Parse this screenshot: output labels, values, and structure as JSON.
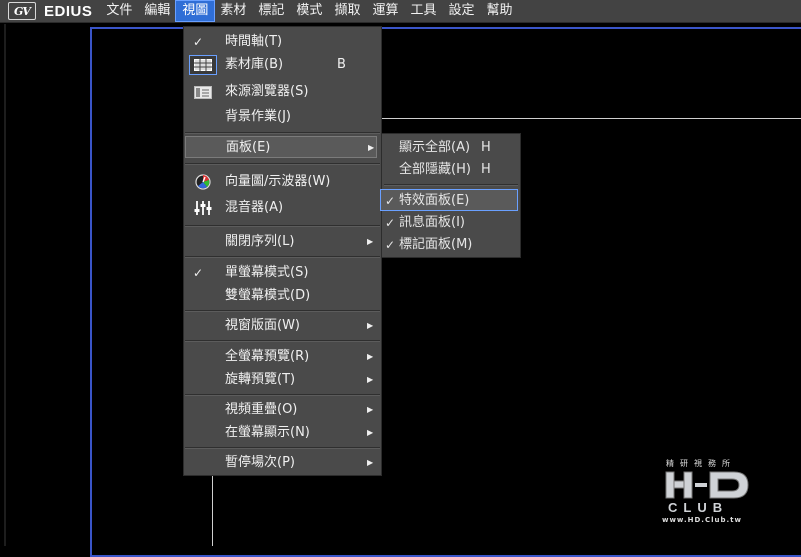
{
  "app": {
    "logo_mark": "GV",
    "name": "EDIUS"
  },
  "menubar": {
    "items": [
      {
        "label": "文件"
      },
      {
        "label": "編輯"
      },
      {
        "label": "視圖",
        "active": true
      },
      {
        "label": "素材"
      },
      {
        "label": "標記"
      },
      {
        "label": "模式"
      },
      {
        "label": "擷取"
      },
      {
        "label": "運算"
      },
      {
        "label": "工具"
      },
      {
        "label": "設定"
      },
      {
        "label": "幫助"
      }
    ]
  },
  "view_menu": {
    "items": [
      {
        "label": "時間軸(T)",
        "checked": true
      },
      {
        "label": "素材庫(B)",
        "shortcut": "B",
        "icon": "grid-icon"
      },
      {
        "label": "來源瀏覽器(S)",
        "icon": "browser-icon"
      },
      {
        "label": "背景作業(J)"
      },
      {
        "label": "面板(E)",
        "submenu": true
      },
      {
        "label": "向量圖/示波器(W)",
        "icon": "vectorscope-icon"
      },
      {
        "label": "混音器(A)",
        "icon": "mixer-icon"
      },
      {
        "label": "關閉序列(L)",
        "submenu": true
      },
      {
        "label": "單螢幕模式(S)",
        "checked": true
      },
      {
        "label": "雙螢幕模式(D)"
      },
      {
        "label": "視窗版面(W)",
        "submenu": true
      },
      {
        "label": "全螢幕預覽(R)",
        "submenu": true
      },
      {
        "label": "旋轉預覽(T)",
        "submenu": true
      },
      {
        "label": "視頻重疊(O)",
        "submenu": true
      },
      {
        "label": "在螢幕顯示(N)",
        "submenu": true
      },
      {
        "label": "暫停場次(P)",
        "submenu": true
      }
    ],
    "check_glyph": "✓",
    "arrow_glyph": "▶"
  },
  "panel_submenu": {
    "items": [
      {
        "label": "顯示全部(A)",
        "shortcut": "H"
      },
      {
        "label": "全部隱藏(H)",
        "shortcut": "H"
      },
      {
        "label": "特效面板(E)",
        "checked": true
      },
      {
        "label": "訊息面板(I)",
        "checked": true
      },
      {
        "label": "標記面板(M)",
        "checked": true
      }
    ]
  },
  "watermark": {
    "top": "精研視務所",
    "url": "www.HD.Club.tw"
  },
  "colors": {
    "menubar": "#434343",
    "menu_bg": "#4a4a4a",
    "accent": "#2f6ed6",
    "preview_border": "#3a55c9"
  }
}
